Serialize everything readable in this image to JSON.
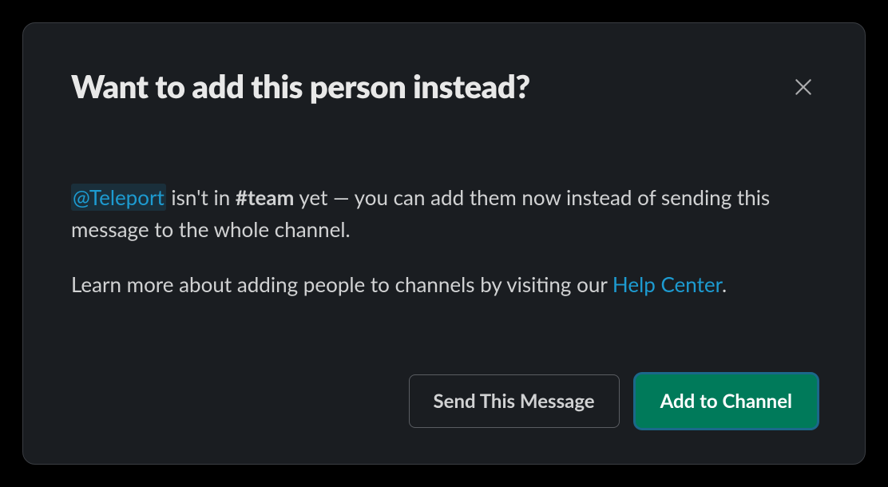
{
  "modal": {
    "title": "Want to add this person instead?",
    "mention": "@Teleport",
    "body_text_1a": " isn't in ",
    "channel": "#team",
    "body_text_1b": " yet — you can add them now instead of sending this message to the whole channel.",
    "body_text_2a": "Learn more about adding people to channels by visiting our ",
    "help_link": "Help Center",
    "body_text_2b": ".",
    "buttons": {
      "secondary": "Send This Message",
      "primary": "Add to Channel"
    }
  }
}
